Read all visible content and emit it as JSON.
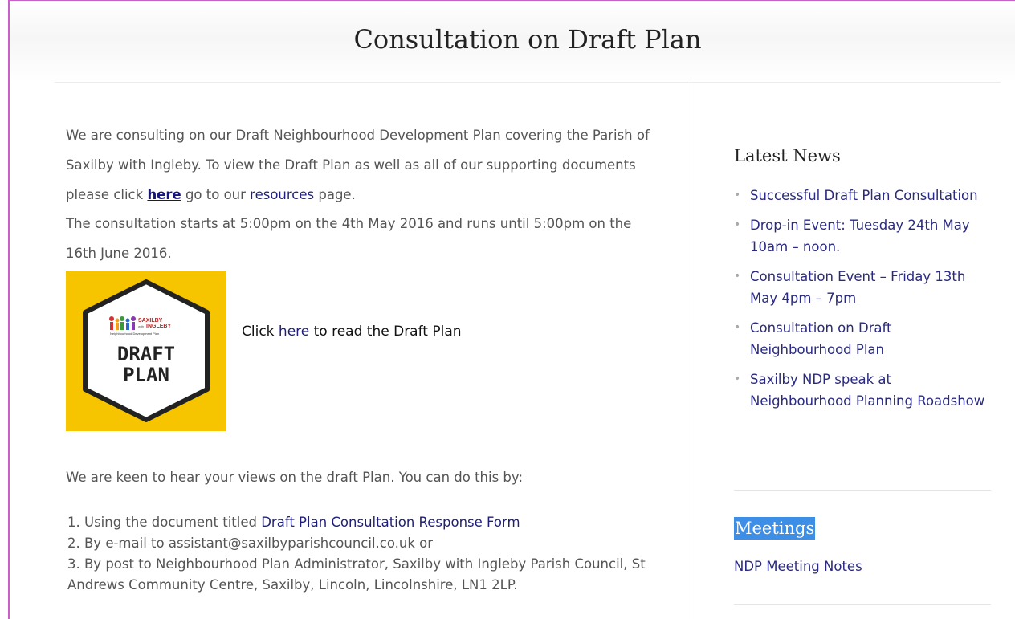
{
  "header": {
    "title": "Consultation on Draft Plan"
  },
  "intro": {
    "before_here": "We are consulting on our Draft Neighbourhood Development Plan covering the Parish of Saxilby with Ingleby. To view the Draft Plan as well as all of our supporting documents please click ",
    "here_link": "here",
    "middle": " go to our ",
    "resources_link": "resources",
    "after": " page."
  },
  "consultation_dates": "The consultation starts at 5:00pm on the 4th May 2016 and runs until 5:00pm on the 16th June 2016.",
  "badge": {
    "brand_top": "SAXILBY",
    "brand_with": "with",
    "brand_bottom": "INGLEBY",
    "brand_sub": "Neighbourhood Development Plan",
    "line1": "DRAFT",
    "line2": "PLAN",
    "bg_color": "#f7c400"
  },
  "badge_caption": {
    "prefix": "Click ",
    "link": "here",
    "suffix": " to read the Draft Plan"
  },
  "keen_text": "We are keen to hear your views on the draft Plan. You can do this by:",
  "methods": {
    "m1_prefix": "1. Using the document titled ",
    "m1_link": "Draft Plan Consultation Response Form",
    "m2": "2. By e-mail to assistant@saxilbyparishcouncil.co.uk or",
    "m3": "3. By post to Neighbourhood Plan Administrator, Saxilby with Ingleby Parish Council, St Andrews Community Centre, Saxilby, Lincoln, Lincolnshire, LN1 2LP."
  },
  "sidebar": {
    "news_heading": "Latest News",
    "news_items": [
      "Successful Draft Plan Consultation",
      "Drop-in Event: Tuesday 24th May 10am – noon.",
      "Consultation Event – Friday 13th May 4pm – 7pm",
      "Consultation on Draft Neighbourhood Plan",
      "Saxilby NDP speak at Neighbourhood Planning Roadshow"
    ],
    "meetings_heading": "Meetings",
    "meeting_link": "NDP Meeting Notes"
  },
  "colors": {
    "link": "#1f1f7a",
    "frame": "#c95fc9",
    "selection": "#3d8ee6"
  }
}
